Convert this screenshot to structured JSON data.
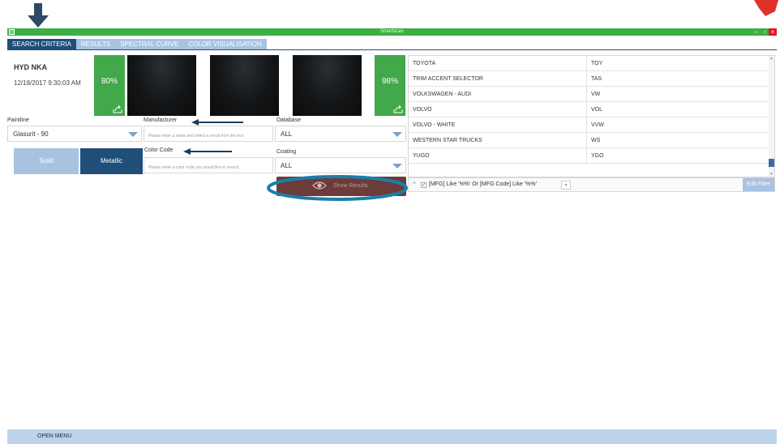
{
  "window": {
    "title": "Smartscan",
    "minimize": "–",
    "maximize": "▫",
    "close": "×"
  },
  "tabs": [
    {
      "label": "SEARCH CRITERIA",
      "active": true
    },
    {
      "label": "RESULTS",
      "active": false
    },
    {
      "label": "SPECTRAL CURVE",
      "active": false
    },
    {
      "label": "COLOR VISUALISATION",
      "active": false
    }
  ],
  "paint": {
    "name": "HYD NKA",
    "datetime": "12/18/2017 9:30:03 AM"
  },
  "match_left": {
    "percent": "80%"
  },
  "match_right": {
    "percent": "98%"
  },
  "form": {
    "paintline_label": "Paintline",
    "paintline_value": "Glasurit - 90",
    "manufacturer_label": "Manufacturer",
    "manufacturer_placeholder": "Please enter a name and select a result from the box",
    "database_label": "Database",
    "database_value": "ALL",
    "color_code_label": "Color Code",
    "color_code_placeholder": "Please enter a color code you would like to search.",
    "coating_label": "Coating",
    "coating_value": "ALL",
    "solid_label": "Solid",
    "metallic_label": "Metallic",
    "show_results_label": "Show Results"
  },
  "manufacturers": [
    {
      "name": "TOYOTA",
      "code": "TOY"
    },
    {
      "name": "TRIM ACCENT SELECTOR",
      "code": "TAS"
    },
    {
      "name": "VOLKSWAGEN - AUDI",
      "code": "VW"
    },
    {
      "name": "VOLVO",
      "code": "VOL"
    },
    {
      "name": "VOLVO - WHITE",
      "code": "VVW"
    },
    {
      "name": "WESTERN STAR TRUCKS",
      "code": "WS"
    },
    {
      "name": "YUGO",
      "code": "YGO"
    }
  ],
  "filter": {
    "clear": "×",
    "checked": "✓",
    "expression": "[MFG] Like '%%' Or [MFG Code] Like '%%'",
    "dropdown": "▾",
    "edit_label": "Edit Filter"
  },
  "footer": {
    "open_menu": "OPEN MENU"
  },
  "colors": {
    "titlebar_green": "#3cb043",
    "tab_active": "#1f4e79",
    "tab_inactive": "#a7c3e0",
    "match_green": "#42a84a",
    "show_results_bg": "#6d3b39",
    "highlight_ring": "#1a7fa8",
    "annotation_arrow": "#1f3b57"
  }
}
